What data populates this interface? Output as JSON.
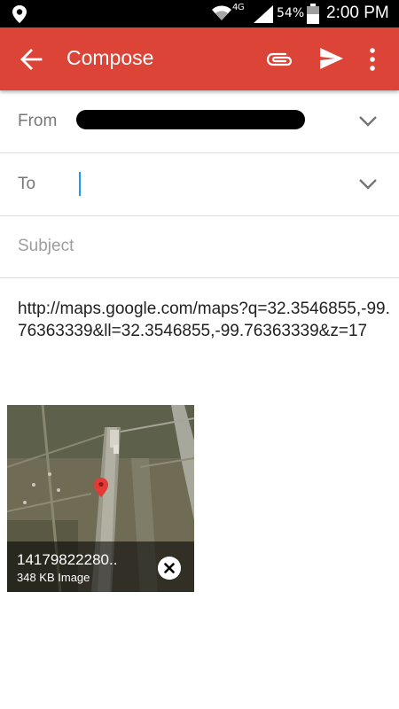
{
  "status_bar": {
    "network": "4G",
    "battery_percent": "54%",
    "time": "2:00 PM"
  },
  "app_bar": {
    "title": "Compose"
  },
  "fields": {
    "from_label": "From",
    "to_label": "To",
    "subject_placeholder": "Subject"
  },
  "body": {
    "text": "http://maps.google.com/maps?q=32.3546855,-99.76363339&ll=32.3546855,-99.76363339&z=17"
  },
  "attachment": {
    "filename": "14179822280..",
    "size": "348 KB Image"
  },
  "icons": {
    "back": "arrow-back-icon",
    "attach": "paperclip-icon",
    "send": "send-icon",
    "more": "more-vert-icon",
    "expand": "chevron-down-icon",
    "remove": "close-icon",
    "pin": "map-pin-icon"
  },
  "colors": {
    "accent": "#db4437",
    "status_bar": "#000000",
    "caret": "#2196f3"
  }
}
